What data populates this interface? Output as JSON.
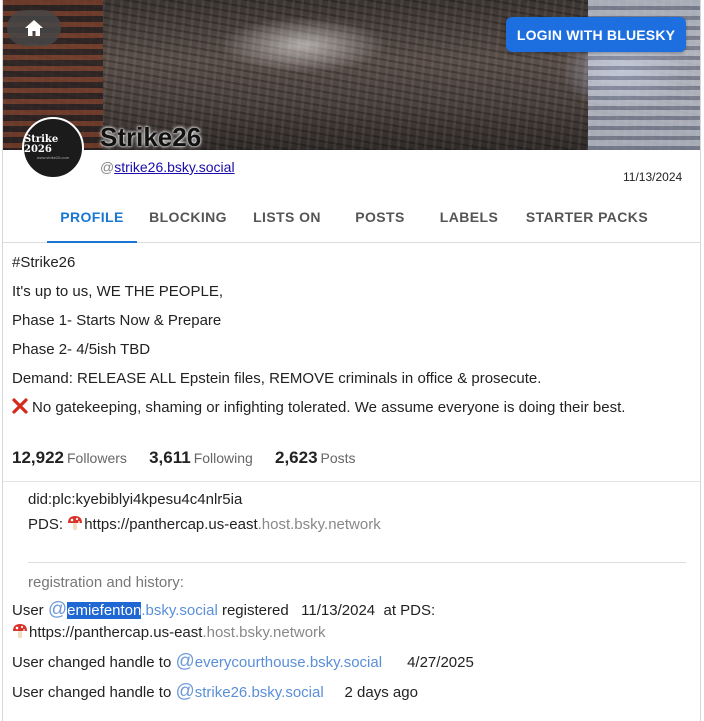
{
  "header": {
    "login_label": "LOGIN WITH BLUESKY"
  },
  "profile": {
    "avatar_text": "Strike 2026",
    "avatar_subtext": "www.strike26.com",
    "display_name": "Strike26",
    "handle_prefix": "@",
    "handle": "strike26.bsky.social",
    "created": "11/13/2024"
  },
  "tabs": [
    {
      "label": "PROFILE"
    },
    {
      "label": "BLOCKING"
    },
    {
      "label": "LISTS ON"
    },
    {
      "label": "POSTS"
    },
    {
      "label": "LABELS"
    },
    {
      "label": "STARTER PACKS"
    }
  ],
  "bio": [
    "#Strike26",
    "It's up to us, WE THE PEOPLE,",
    "Phase 1- Starts Now & Prepare",
    "Phase 2- 4/5ish TBD",
    "Demand: RELEASE ALL Epstein files, REMOVE criminals in office & prosecute.",
    "No gatekeeping, shaming or infighting tolerated. We assume everyone is doing their best."
  ],
  "stats": {
    "followers": {
      "value": "12,922",
      "label": "Followers"
    },
    "following": {
      "value": "3,611",
      "label": "Following"
    },
    "posts": {
      "value": "2,623",
      "label": "Posts"
    }
  },
  "identity": {
    "did": "did:plc:kyebiblyi4kpesu4c4nlr5ia",
    "pds_label": "PDS:",
    "pds_url_dark": "https://panthercap.us-east",
    "pds_url_grey": ".host.bsky.network"
  },
  "history": {
    "heading": "registration and history:",
    "registered": {
      "prefix": "User",
      "at": "@",
      "handle_selected": "emiefenton",
      "handle_rest": ".bsky.social",
      "verb": "registered",
      "date": "11/13/2024",
      "at_pds": "at PDS:",
      "pds_url_dark": "https://panthercap.us-east",
      "pds_url_grey": ".host.bsky.network"
    },
    "changes": [
      {
        "prefix": "User changed handle to",
        "at": "@",
        "handle": "everycourthouse.bsky.social",
        "when": "4/27/2025"
      },
      {
        "prefix": "User changed handle to",
        "at": "@",
        "handle": "strike26.bsky.social",
        "when": "2 days ago"
      }
    ]
  },
  "colors": {
    "accent": "#1976d2",
    "login_button": "#1d6fe0",
    "link": "#5a8fd8",
    "selection": "#1f67d2"
  },
  "icons": {
    "home": "home-icon",
    "mushroom": "mushroom-icon",
    "cross": "cross-mark-icon"
  }
}
